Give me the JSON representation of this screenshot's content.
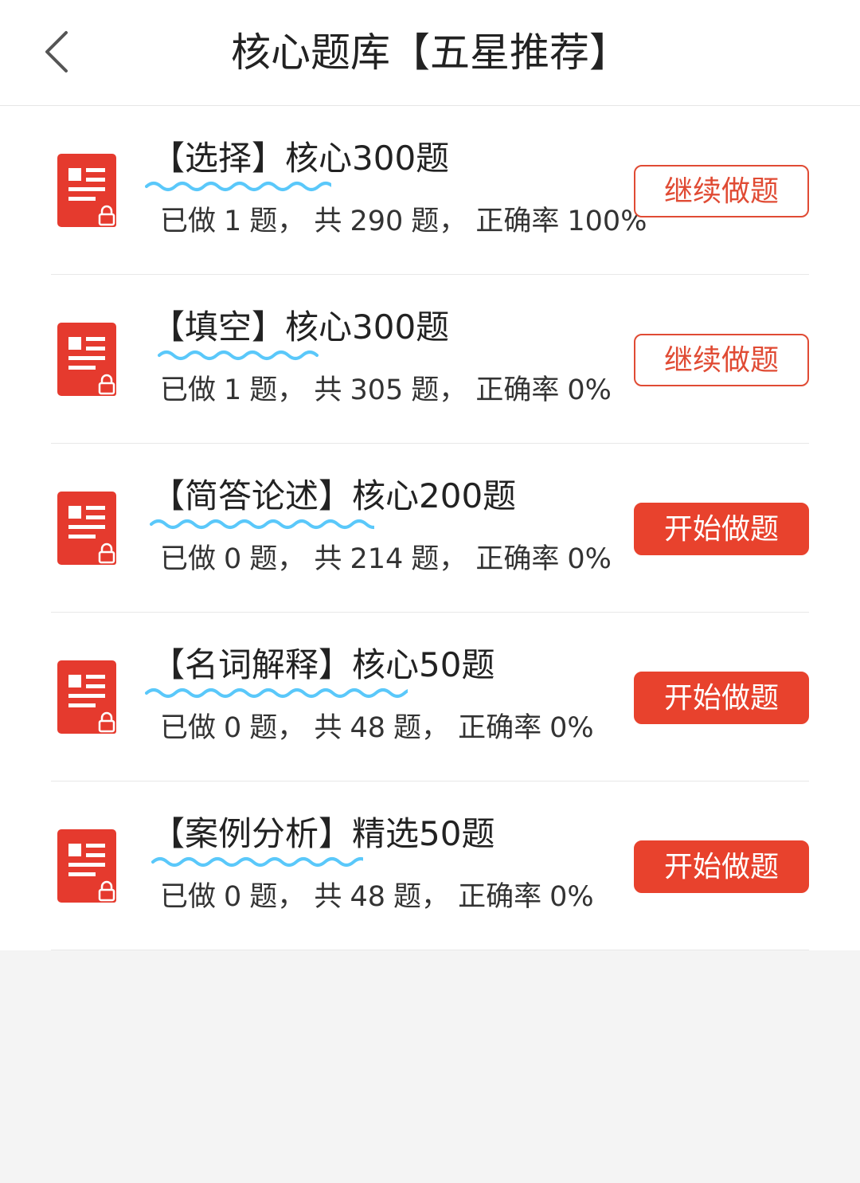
{
  "header": {
    "title": "核心题库【五星推荐】",
    "back_icon": "chevron-left-icon"
  },
  "colors": {
    "accent": "#e8422d",
    "icon_red": "#e53a2e",
    "wavy_underline": "#5ac8fa"
  },
  "items": [
    {
      "title": "【选择】核心300题",
      "done_prefix": "已做",
      "done": "1",
      "total_prefix": "题， 共",
      "total": "290",
      "accuracy_prefix": "题， 正确率",
      "accuracy": "100%",
      "button": "继续做题",
      "button_style": "outline"
    },
    {
      "title": "【填空】核心300题",
      "done_prefix": "已做",
      "done": "1",
      "total_prefix": "题， 共",
      "total": "305",
      "accuracy_prefix": "题， 正确率",
      "accuracy": "0%",
      "button": "继续做题",
      "button_style": "outline"
    },
    {
      "title": "【简答论述】核心200题",
      "done_prefix": "已做",
      "done": "0",
      "total_prefix": "题， 共",
      "total": "214",
      "accuracy_prefix": "题， 正确率",
      "accuracy": "0%",
      "button": "开始做题",
      "button_style": "solid"
    },
    {
      "title": "【名词解释】核心50题",
      "done_prefix": "已做",
      "done": "0",
      "total_prefix": "题， 共",
      "total": "48",
      "accuracy_prefix": "题， 正确率",
      "accuracy": "0%",
      "button": "开始做题",
      "button_style": "solid"
    },
    {
      "title": "【案例分析】精选50题",
      "done_prefix": "已做",
      "done": "0",
      "total_prefix": "题， 共",
      "total": "48",
      "accuracy_prefix": "题， 正确率",
      "accuracy": "0%",
      "button": "开始做题",
      "button_style": "solid"
    }
  ]
}
